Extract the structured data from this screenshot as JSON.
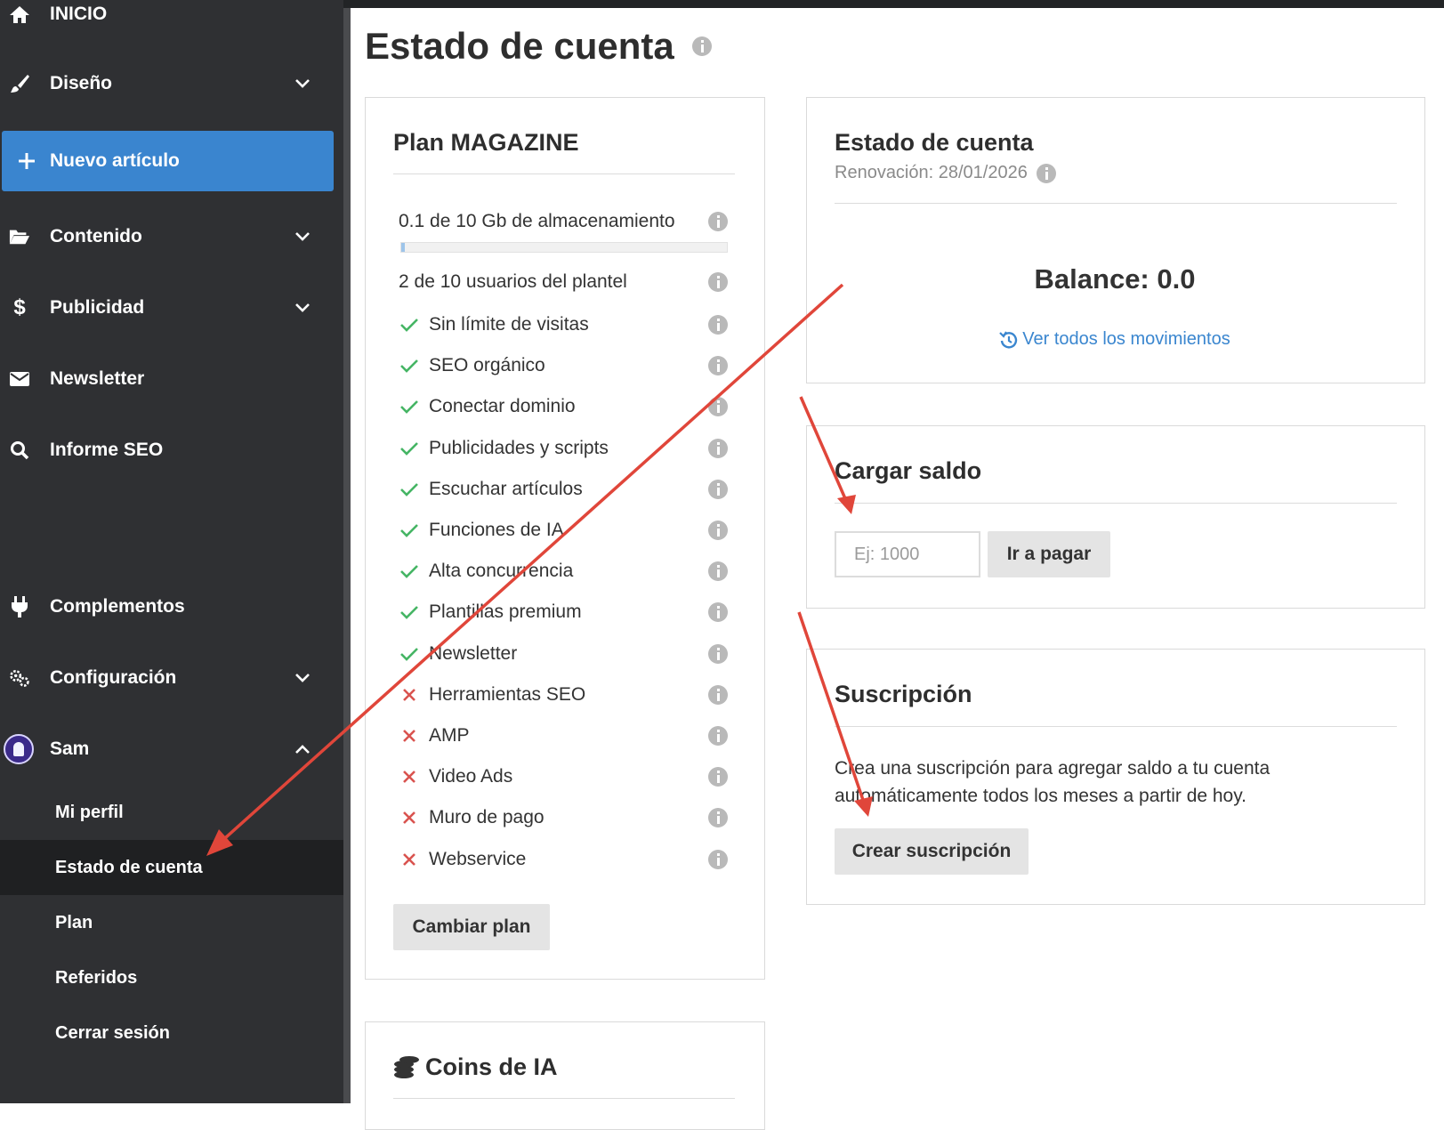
{
  "sidebar": {
    "items": [
      {
        "label": "INICIO",
        "icon": "home-icon"
      },
      {
        "label": "Diseño",
        "icon": "brush-icon"
      },
      {
        "label": "Nuevo artículo",
        "icon": "plus-icon"
      },
      {
        "label": "Contenido",
        "icon": "folder-icon"
      },
      {
        "label": "Publicidad",
        "icon": "dollar-icon"
      },
      {
        "label": "Newsletter",
        "icon": "envelope-icon"
      },
      {
        "label": "Informe SEO",
        "icon": "search-icon"
      },
      {
        "label": "Complementos",
        "icon": "plug-icon"
      },
      {
        "label": "Configuración",
        "icon": "gears-icon"
      },
      {
        "label": "Sam",
        "icon": "avatar"
      }
    ],
    "user_menu": [
      "Mi perfil",
      "Estado de cuenta",
      "Plan",
      "Referidos",
      "Cerrar sesión"
    ]
  },
  "page": {
    "title": "Estado de cuenta"
  },
  "plan": {
    "title": "Plan MAGAZINE",
    "storage": {
      "label": "0.1 de 10 Gb de almacenamiento",
      "fraction": 0.01
    },
    "users": "2 de 10 usuarios del plantel",
    "features": [
      {
        "label": "Sin límite de visitas",
        "included": true
      },
      {
        "label": "SEO orgánico",
        "included": true
      },
      {
        "label": "Conectar dominio",
        "included": true
      },
      {
        "label": "Publicidades y scripts",
        "included": true
      },
      {
        "label": "Escuchar artículos",
        "included": true
      },
      {
        "label": "Funciones de IA",
        "included": true
      },
      {
        "label": "Alta concurrencia",
        "included": true
      },
      {
        "label": "Plantillas premium",
        "included": true
      },
      {
        "label": "Newsletter",
        "included": true
      },
      {
        "label": "Herramientas SEO",
        "included": false
      },
      {
        "label": "AMP",
        "included": false
      },
      {
        "label": "Video Ads",
        "included": false
      },
      {
        "label": "Muro de pago",
        "included": false
      },
      {
        "label": "Webservice",
        "included": false
      }
    ],
    "change_button": "Cambiar plan"
  },
  "coins": {
    "title": "Coins de IA"
  },
  "account": {
    "title": "Estado de cuenta",
    "renewal": "Renovación: 28/01/2026",
    "balance": "Balance: 0.0",
    "movements_link": "Ver todos los movimientos"
  },
  "load": {
    "title": "Cargar saldo",
    "placeholder": "Ej: 1000",
    "pay_button": "Ir a pagar"
  },
  "subscription": {
    "title": "Suscripción",
    "text_line1": "Crea una suscripción para agregar saldo a tu cuenta",
    "text_line2": "automáticamente todos los meses a partir de hoy.",
    "button": "Crear suscripción"
  },
  "colors": {
    "sidebar_bg": "#2f3033",
    "accent": "#3a85cf",
    "check": "#45b564",
    "cross": "#d9534f",
    "annotation_arrow": "#e0463a"
  }
}
